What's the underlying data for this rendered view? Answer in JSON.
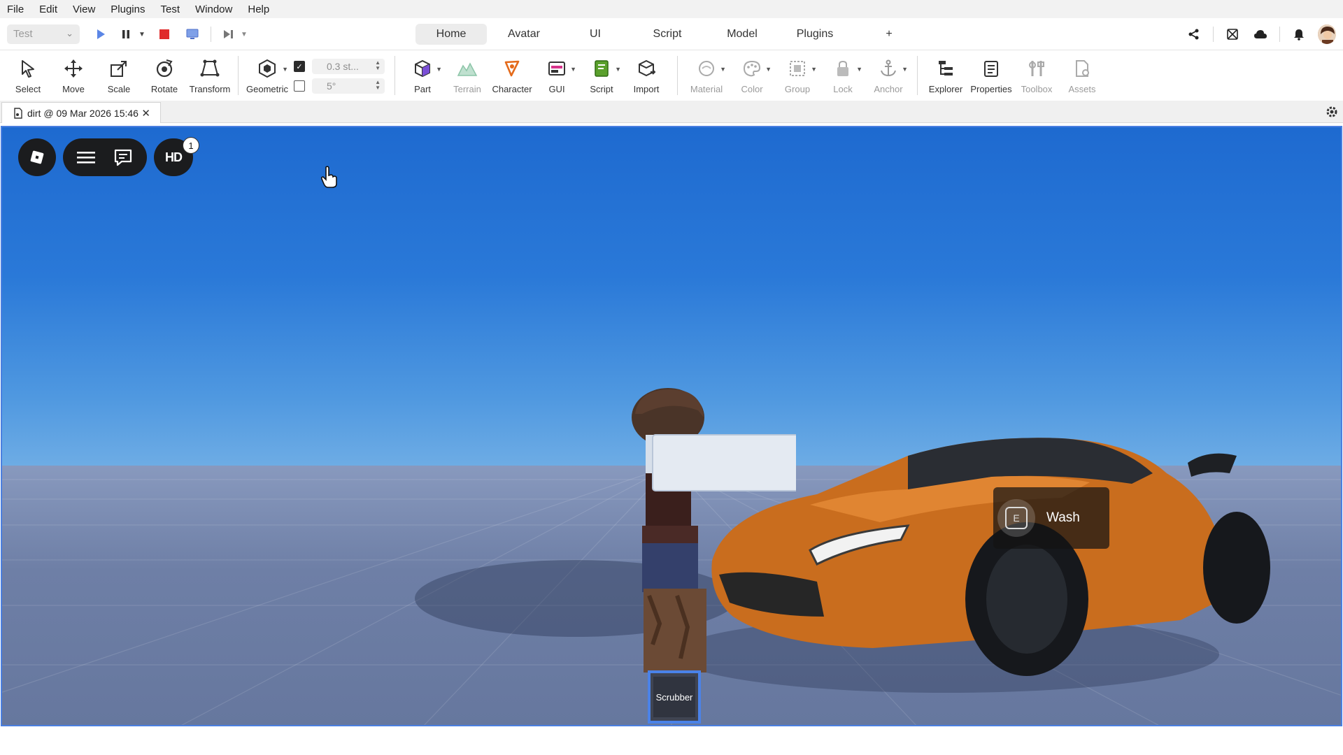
{
  "menu": [
    "File",
    "Edit",
    "View",
    "Plugins",
    "Test",
    "Window",
    "Help"
  ],
  "topbar": {
    "mode_select": "Test",
    "tabs": [
      {
        "label": "Home",
        "active": true
      },
      {
        "label": "Avatar",
        "active": false
      },
      {
        "label": "UI",
        "active": false
      },
      {
        "label": "Script",
        "active": false
      },
      {
        "label": "Model",
        "active": false
      },
      {
        "label": "Plugins",
        "active": false
      },
      {
        "label": "+",
        "active": false
      }
    ],
    "right_icons": [
      "share-icon",
      "collab-icon",
      "cloud-icon",
      "bell-icon"
    ]
  },
  "ribbon": {
    "tools": [
      {
        "label": "Select"
      },
      {
        "label": "Move"
      },
      {
        "label": "Scale"
      },
      {
        "label": "Rotate"
      },
      {
        "label": "Transform"
      },
      {
        "label": "Geometric"
      },
      {
        "label": "Part"
      },
      {
        "label": "Terrain"
      },
      {
        "label": "Character"
      },
      {
        "label": "GUI"
      },
      {
        "label": "Script"
      },
      {
        "label": "Import"
      },
      {
        "label": "Material"
      },
      {
        "label": "Color"
      },
      {
        "label": "Group"
      },
      {
        "label": "Lock"
      },
      {
        "label": "Anchor"
      },
      {
        "label": "Explorer"
      },
      {
        "label": "Properties"
      },
      {
        "label": "Toolbox"
      },
      {
        "label": "Assets"
      }
    ],
    "snap": {
      "move_enabled": true,
      "move_value": "0.3 st...",
      "rotate_enabled": false,
      "rotate_value": "5°"
    }
  },
  "document_tab": {
    "title": "dirt @ 09 Mar 2026 15:46"
  },
  "viewport": {
    "hd_label": "HD",
    "notification_count": "1",
    "prompt": {
      "key": "E",
      "action": "Wash"
    },
    "hotbar": {
      "slot_label": "Scrubber"
    }
  },
  "colors": {
    "accent": "#4a7fe0",
    "stop_red": "#e02b2b",
    "sky_top": "#1e6ad0",
    "car_orange": "#c96d1e"
  }
}
